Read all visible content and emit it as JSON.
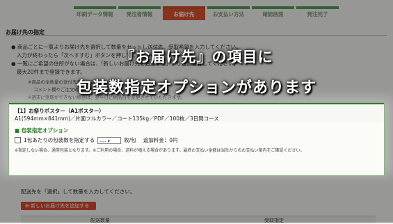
{
  "steps": [
    {
      "label": "印刷データ情報",
      "state": "done"
    },
    {
      "label": "発注者情報",
      "state": "done"
    },
    {
      "label": "お届け先",
      "state": "active"
    },
    {
      "label": "お支払い方法",
      "state": "todo"
    },
    {
      "label": "確認画面",
      "state": "todo"
    },
    {
      "label": "発注完了",
      "state": "todo"
    }
  ],
  "section_title": "お届け先の指定",
  "instructions": [
    "● 商品ごとに一覧よりお届け先を選択して数量をセットし送付先、受取希望を入力してください。",
    "入力が終わったら「次へすすむ」ボタンを押してください。",
    "● 一覧にご希望の住所がない場合は、「新しいお届け先を追加する」より追加登録してください。",
    "最大20件まで登録できます。",
    "※商品の全数量の送付先をご指定ください。",
    "コメント欄やご注文確認のお電話でご連絡ください。",
    "※週末に受取ができない場合は、翌平日に納品日を変更させていただきます。"
  ],
  "overlay": {
    "line1": "『お届け先』の項目に",
    "line2": "包装数指定オプションがあります"
  },
  "product": {
    "name": "【1】お祭りポスター（A1ポスター）",
    "spec": "A1(594mm×841mm)／片面フルカラー／コート135kg／PDF／100枚／3日間コース"
  },
  "packaging_option": {
    "title": "■ 包装指定オプション",
    "checkbox_label": "1包あたりの包装数を指定する",
    "select_value": "----",
    "unit": "枚/包",
    "fee_label": "追加料金：0円",
    "note": "※指定しない場合、通常包装となります。※ご利用の場合、送料が増える場合があります。最終お支払い金額は当社からのお支払い案内をご確認ください。"
  },
  "delivery_prompt": "配送先を「選択」して数量を入力してください。",
  "add_address_button": "新しいお届け先を追加する",
  "table_headers": [
    "配送数量",
    "受取指定"
  ]
}
